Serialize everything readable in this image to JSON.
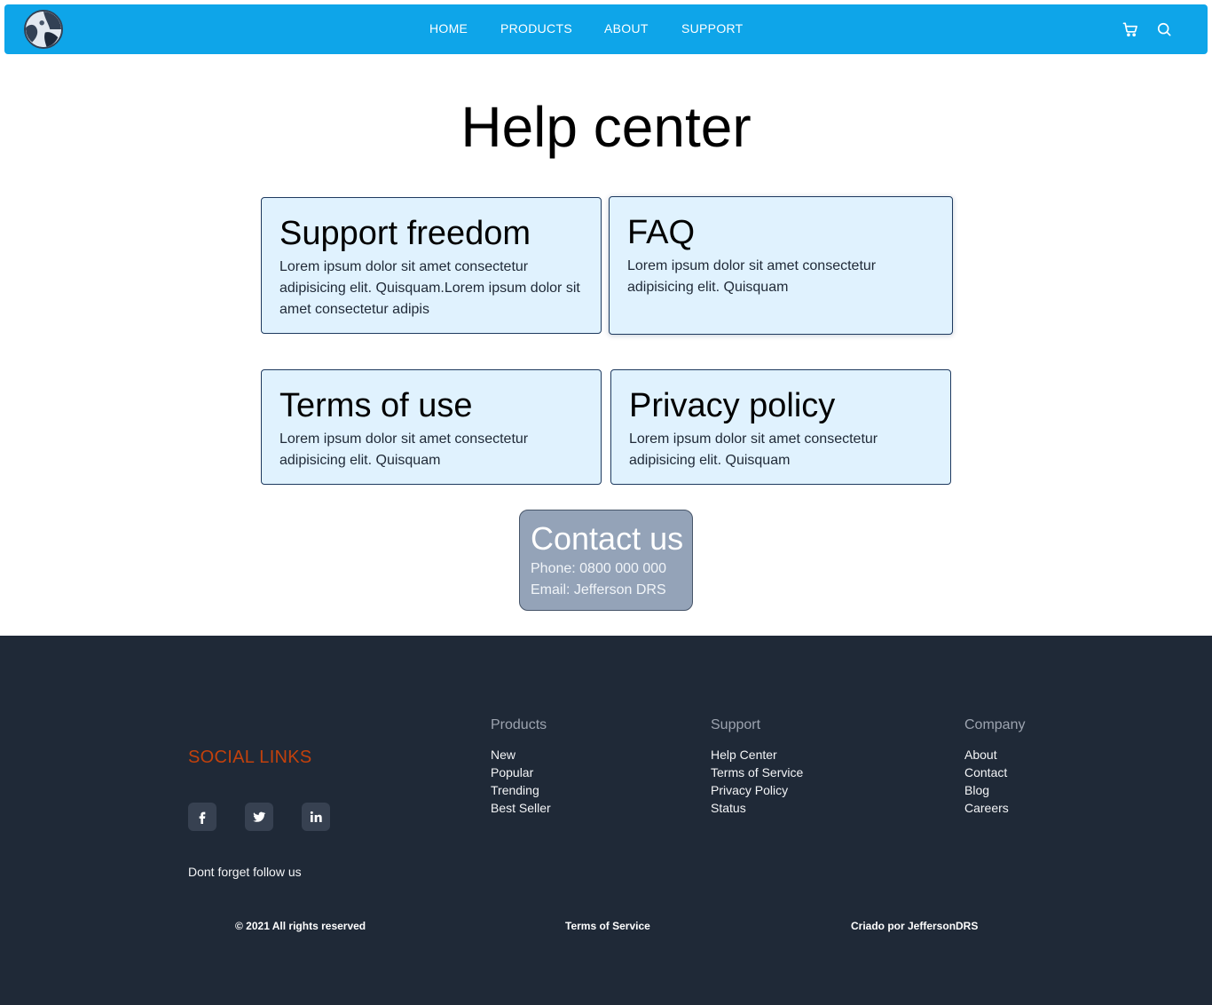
{
  "nav": {
    "links": [
      "HOME",
      "PRODUCTS",
      "ABOUT",
      "SUPPORT"
    ],
    "icons": [
      "cart-icon",
      "search-icon"
    ]
  },
  "main": {
    "title": "Help center",
    "cards": [
      {
        "title": "Support freedom",
        "text": "Lorem ipsum dolor sit amet consectetur adipisicing elit. Quisquam.Lorem ipsum dolor sit amet consectetur adipis"
      },
      {
        "title": "FAQ",
        "text": "Lorem ipsum dolor sit amet consectetur adipisicing elit. Quisquam"
      },
      {
        "title": "Terms of use",
        "text": "Lorem ipsum dolor sit amet consectetur adipisicing elit. Quisquam"
      },
      {
        "title": "Privacy policy",
        "text": "Lorem ipsum dolor sit amet consectetur adipisicing elit. Quisquam"
      }
    ],
    "contact": {
      "title": "Contact us",
      "phone": "Phone: 0800 000 000",
      "email": "Email: Jefferson DRS"
    }
  },
  "footer": {
    "social_title": "SOCIAL LINKS",
    "social_icons": [
      "facebook-icon",
      "twitter-icon",
      "linkedin-icon"
    ],
    "follow_text": "Dont forget follow us",
    "columns": [
      {
        "title": "Products",
        "links": [
          "New",
          "Popular",
          "Trending",
          "Best Seller"
        ]
      },
      {
        "title": "Support",
        "links": [
          "Help Center",
          "Terms of Service",
          "Privacy Policy",
          "Status"
        ]
      },
      {
        "title": "Company",
        "links": [
          "About",
          "Contact",
          "Blog",
          "Careers"
        ]
      }
    ],
    "copyright": "© 2021 All rights reserved",
    "terms": "Terms of Service",
    "credit": "Criado por JeffersonDRS"
  },
  "colors": {
    "navbar": "#0ea5e9",
    "card_bg": "#e0f2fe",
    "contact_bg": "#94a3b8",
    "footer_bg": "#1f2937",
    "social_title": "#c2410c"
  }
}
